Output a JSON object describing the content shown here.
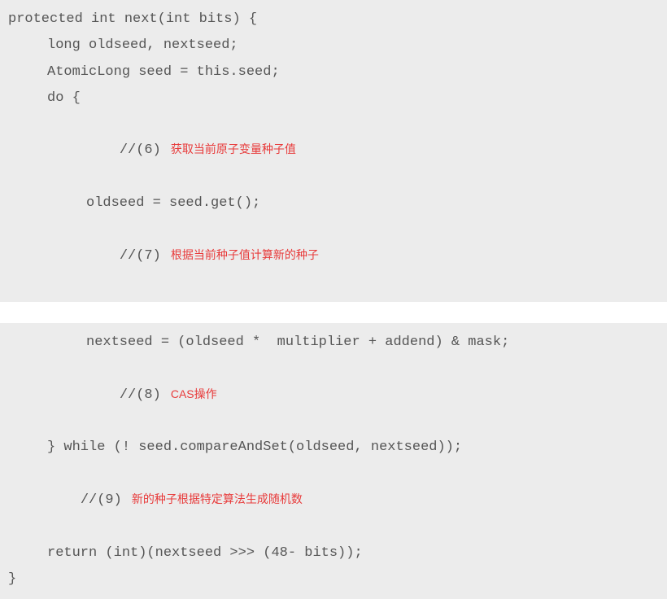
{
  "code": {
    "line1": "protected int next(int bits) {",
    "line2": "long oldseed, nextseed;",
    "line3": "AtomicLong seed = this.seed;",
    "line4": "do {",
    "line5_comment": "//(6)",
    "line5_annotation": "获取当前原子变量种子值",
    "line6": "oldseed = seed.get();",
    "line7_comment": "//(7)",
    "line7_annotation": "根据当前种子值计算新的种子",
    "line8": "nextseed = (oldseed *  multiplier + addend) & mask;",
    "line9_comment": "//(8)",
    "line9_annotation": "CAS操作",
    "line10": "} while (! seed.compareAndSet(oldseed, nextseed));",
    "line11_comment": "//(9)",
    "line11_annotation": "新的种子根据特定算法生成随机数",
    "line12": "return (int)(nextseed >>> (48- bits));",
    "line13": "}"
  }
}
